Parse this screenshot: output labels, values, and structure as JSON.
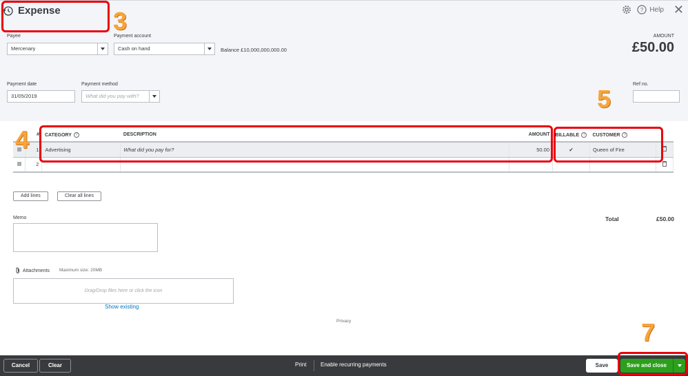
{
  "header": {
    "title": "Expense",
    "help_label": "Help"
  },
  "payee": {
    "label": "Payee",
    "value": "Mercenary"
  },
  "payment_account": {
    "label": "Payment account",
    "value": "Cash on hand",
    "balance": "Balance £10,000,000,000.00"
  },
  "amount_summary": {
    "label": "AMOUNT",
    "value": "£50.00"
  },
  "payment_date": {
    "label": "Payment date",
    "value": "31/05/2019"
  },
  "payment_method": {
    "label": "Payment method",
    "placeholder": "What did you pay with?"
  },
  "ref_no": {
    "label": "Ref no.",
    "value": ""
  },
  "table": {
    "columns": {
      "num": "#",
      "category": "CATEGORY",
      "description": "DESCRIPTION",
      "amount": "AMOUNT",
      "billable": "BILLABLE",
      "customer": "CUSTOMER"
    },
    "rows": [
      {
        "num": "1",
        "category": "Advertising",
        "description_placeholder": "What did you pay for?",
        "amount": "50.00",
        "billable": "✔",
        "customer": "Queen of Fire"
      },
      {
        "num": "2",
        "category": "",
        "description_placeholder": "",
        "amount": "",
        "billable": "",
        "customer": ""
      }
    ]
  },
  "buttons": {
    "add_lines": "Add lines",
    "clear_all_lines": "Clear all lines"
  },
  "memo": {
    "label": "Memo"
  },
  "total": {
    "label": "Total",
    "value": "£50.00"
  },
  "attachments": {
    "label": "Attachments",
    "max_size": "Maximum size: 20MB",
    "drop_text": "Drag/Drop files here or click the icon",
    "show_existing": "Show existing"
  },
  "privacy": "Privacy",
  "footer": {
    "cancel": "Cancel",
    "clear": "Clear",
    "print": "Print",
    "recurring": "Enable recurring payments",
    "save": "Save",
    "save_close": "Save and close"
  },
  "annotations": [
    "3",
    "4",
    "5",
    "7"
  ],
  "colors": {
    "accent_green": "#2ca01c",
    "annotation_red": "#e8000b",
    "annotation_number": "#f7a43b",
    "footer_bg": "#393a3d",
    "link_blue": "#0077c5"
  }
}
